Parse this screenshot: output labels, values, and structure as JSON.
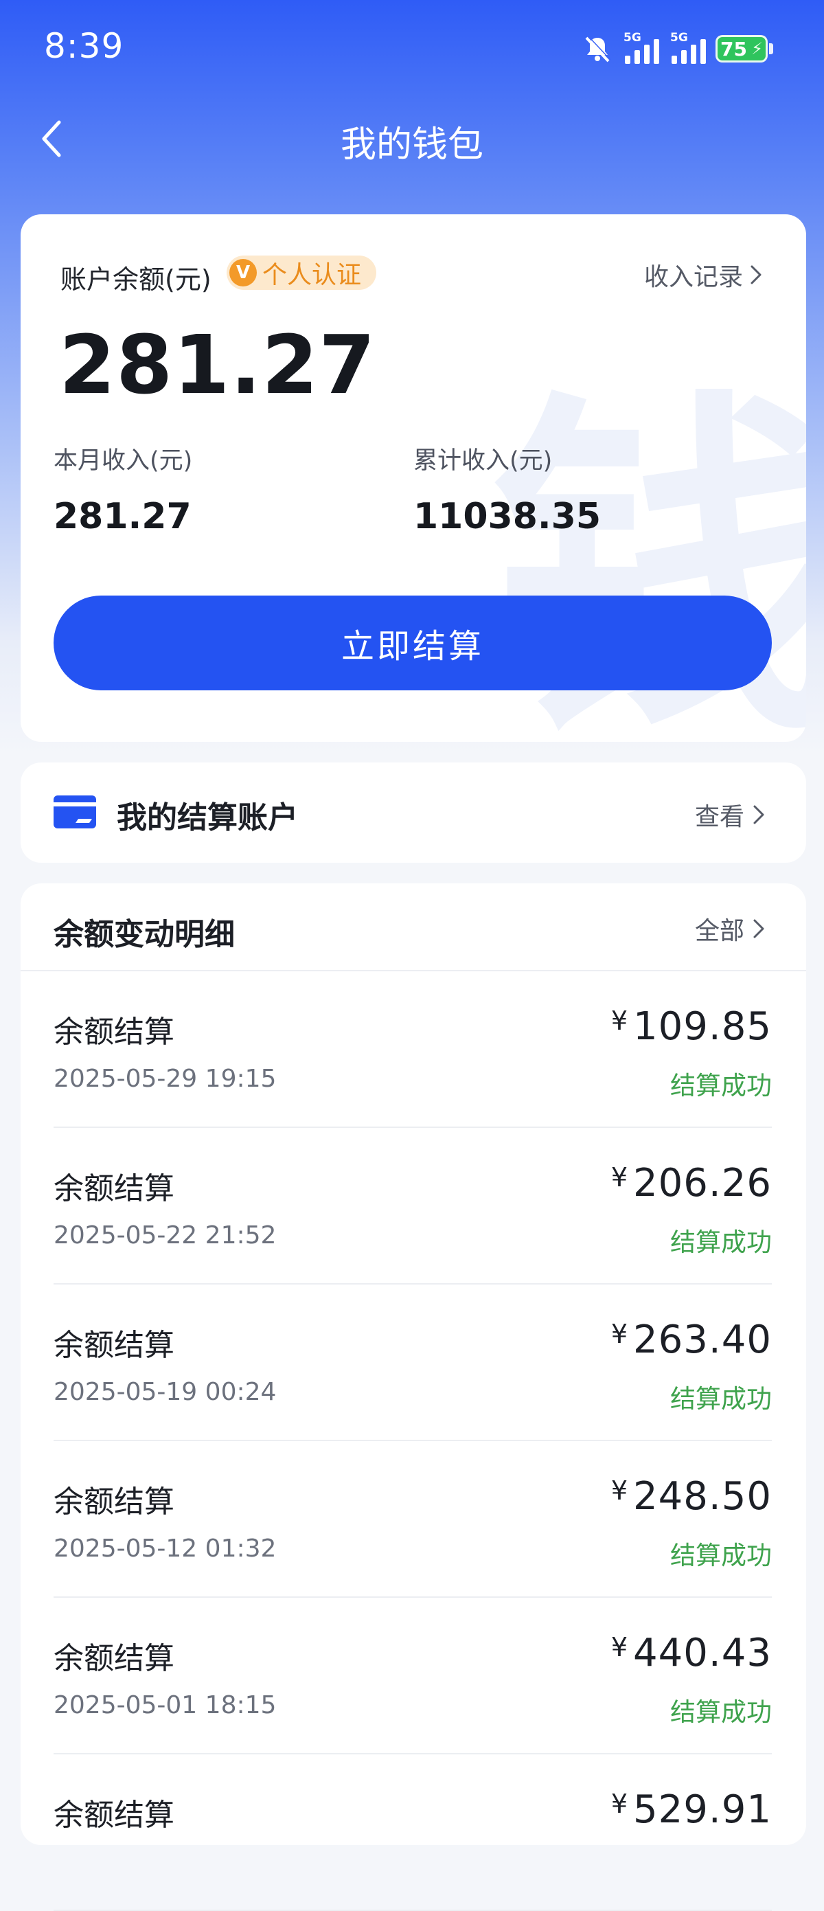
{
  "status_bar": {
    "time": "8:39",
    "network_1": "5G",
    "network_2": "5G",
    "battery": "75"
  },
  "nav": {
    "title": "我的钱包"
  },
  "balance": {
    "label": "账户余额(元)",
    "verify_badge": "个人认证",
    "verify_badge_icon": "V",
    "income_record": "收入记录",
    "amount": "281.27",
    "month_label": "本月收入(元)",
    "month_value": "281.27",
    "total_label": "累计收入(元)",
    "total_value": "11038.35",
    "settle_button": "立即结算",
    "watermark": "钱"
  },
  "account": {
    "title": "我的结算账户",
    "view_link": "查看"
  },
  "details": {
    "title": "余额变动明细",
    "all_link": "全部",
    "currency": "¥",
    "rows": [
      {
        "type": "余额结算",
        "date": "2025-05-29 19:15",
        "amount": "109.85",
        "status": "结算成功"
      },
      {
        "type": "余额结算",
        "date": "2025-05-22 21:52",
        "amount": "206.26",
        "status": "结算成功"
      },
      {
        "type": "余额结算",
        "date": "2025-05-19 00:24",
        "amount": "263.40",
        "status": "结算成功"
      },
      {
        "type": "余额结算",
        "date": "2025-05-12 01:32",
        "amount": "248.50",
        "status": "结算成功"
      },
      {
        "type": "余额结算",
        "date": "2025-05-01 18:15",
        "amount": "440.43",
        "status": "结算成功"
      },
      {
        "type": "余额结算",
        "date": "",
        "amount": "529.91",
        "status": ""
      }
    ]
  },
  "colors": {
    "primary": "#2453f2",
    "success": "#3fa34d",
    "badge_bg": "#fde9cd",
    "badge_text": "#ea8c1c"
  }
}
